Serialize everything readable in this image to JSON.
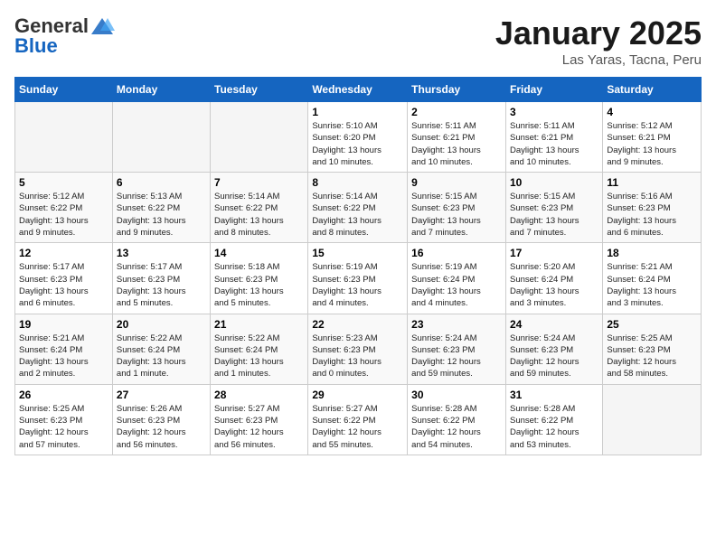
{
  "header": {
    "logo_general": "General",
    "logo_blue": "Blue",
    "calendar_title": "January 2025",
    "calendar_subtitle": "Las Yaras, Tacna, Peru"
  },
  "weekdays": [
    "Sunday",
    "Monday",
    "Tuesday",
    "Wednesday",
    "Thursday",
    "Friday",
    "Saturday"
  ],
  "weeks": [
    [
      {
        "day": "",
        "info": ""
      },
      {
        "day": "",
        "info": ""
      },
      {
        "day": "",
        "info": ""
      },
      {
        "day": "1",
        "info": "Sunrise: 5:10 AM\nSunset: 6:20 PM\nDaylight: 13 hours\nand 10 minutes."
      },
      {
        "day": "2",
        "info": "Sunrise: 5:11 AM\nSunset: 6:21 PM\nDaylight: 13 hours\nand 10 minutes."
      },
      {
        "day": "3",
        "info": "Sunrise: 5:11 AM\nSunset: 6:21 PM\nDaylight: 13 hours\nand 10 minutes."
      },
      {
        "day": "4",
        "info": "Sunrise: 5:12 AM\nSunset: 6:21 PM\nDaylight: 13 hours\nand 9 minutes."
      }
    ],
    [
      {
        "day": "5",
        "info": "Sunrise: 5:12 AM\nSunset: 6:22 PM\nDaylight: 13 hours\nand 9 minutes."
      },
      {
        "day": "6",
        "info": "Sunrise: 5:13 AM\nSunset: 6:22 PM\nDaylight: 13 hours\nand 9 minutes."
      },
      {
        "day": "7",
        "info": "Sunrise: 5:14 AM\nSunset: 6:22 PM\nDaylight: 13 hours\nand 8 minutes."
      },
      {
        "day": "8",
        "info": "Sunrise: 5:14 AM\nSunset: 6:22 PM\nDaylight: 13 hours\nand 8 minutes."
      },
      {
        "day": "9",
        "info": "Sunrise: 5:15 AM\nSunset: 6:23 PM\nDaylight: 13 hours\nand 7 minutes."
      },
      {
        "day": "10",
        "info": "Sunrise: 5:15 AM\nSunset: 6:23 PM\nDaylight: 13 hours\nand 7 minutes."
      },
      {
        "day": "11",
        "info": "Sunrise: 5:16 AM\nSunset: 6:23 PM\nDaylight: 13 hours\nand 6 minutes."
      }
    ],
    [
      {
        "day": "12",
        "info": "Sunrise: 5:17 AM\nSunset: 6:23 PM\nDaylight: 13 hours\nand 6 minutes."
      },
      {
        "day": "13",
        "info": "Sunrise: 5:17 AM\nSunset: 6:23 PM\nDaylight: 13 hours\nand 5 minutes."
      },
      {
        "day": "14",
        "info": "Sunrise: 5:18 AM\nSunset: 6:23 PM\nDaylight: 13 hours\nand 5 minutes."
      },
      {
        "day": "15",
        "info": "Sunrise: 5:19 AM\nSunset: 6:23 PM\nDaylight: 13 hours\nand 4 minutes."
      },
      {
        "day": "16",
        "info": "Sunrise: 5:19 AM\nSunset: 6:24 PM\nDaylight: 13 hours\nand 4 minutes."
      },
      {
        "day": "17",
        "info": "Sunrise: 5:20 AM\nSunset: 6:24 PM\nDaylight: 13 hours\nand 3 minutes."
      },
      {
        "day": "18",
        "info": "Sunrise: 5:21 AM\nSunset: 6:24 PM\nDaylight: 13 hours\nand 3 minutes."
      }
    ],
    [
      {
        "day": "19",
        "info": "Sunrise: 5:21 AM\nSunset: 6:24 PM\nDaylight: 13 hours\nand 2 minutes."
      },
      {
        "day": "20",
        "info": "Sunrise: 5:22 AM\nSunset: 6:24 PM\nDaylight: 13 hours\nand 1 minute."
      },
      {
        "day": "21",
        "info": "Sunrise: 5:22 AM\nSunset: 6:24 PM\nDaylight: 13 hours\nand 1 minutes."
      },
      {
        "day": "22",
        "info": "Sunrise: 5:23 AM\nSunset: 6:23 PM\nDaylight: 13 hours\nand 0 minutes."
      },
      {
        "day": "23",
        "info": "Sunrise: 5:24 AM\nSunset: 6:23 PM\nDaylight: 12 hours\nand 59 minutes."
      },
      {
        "day": "24",
        "info": "Sunrise: 5:24 AM\nSunset: 6:23 PM\nDaylight: 12 hours\nand 59 minutes."
      },
      {
        "day": "25",
        "info": "Sunrise: 5:25 AM\nSunset: 6:23 PM\nDaylight: 12 hours\nand 58 minutes."
      }
    ],
    [
      {
        "day": "26",
        "info": "Sunrise: 5:25 AM\nSunset: 6:23 PM\nDaylight: 12 hours\nand 57 minutes."
      },
      {
        "day": "27",
        "info": "Sunrise: 5:26 AM\nSunset: 6:23 PM\nDaylight: 12 hours\nand 56 minutes."
      },
      {
        "day": "28",
        "info": "Sunrise: 5:27 AM\nSunset: 6:23 PM\nDaylight: 12 hours\nand 56 minutes."
      },
      {
        "day": "29",
        "info": "Sunrise: 5:27 AM\nSunset: 6:22 PM\nDaylight: 12 hours\nand 55 minutes."
      },
      {
        "day": "30",
        "info": "Sunrise: 5:28 AM\nSunset: 6:22 PM\nDaylight: 12 hours\nand 54 minutes."
      },
      {
        "day": "31",
        "info": "Sunrise: 5:28 AM\nSunset: 6:22 PM\nDaylight: 12 hours\nand 53 minutes."
      },
      {
        "day": "",
        "info": ""
      }
    ]
  ]
}
